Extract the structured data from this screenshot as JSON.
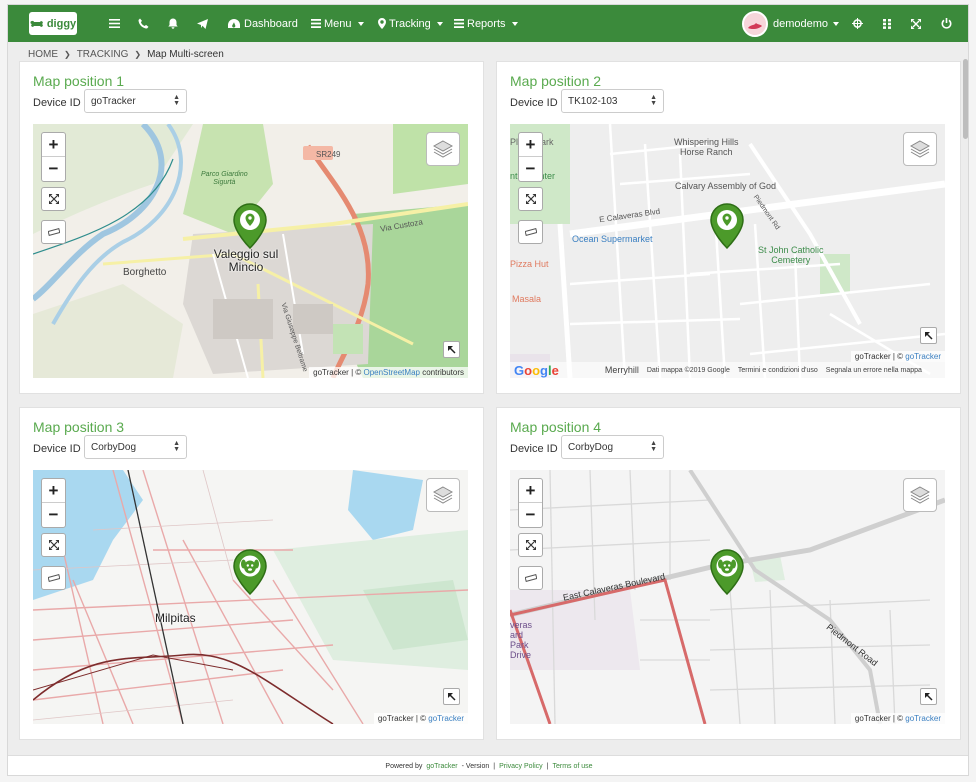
{
  "navbar": {
    "logo_text": "diggy",
    "dashboard": "Dashboard",
    "menu": "Menu",
    "tracking": "Tracking",
    "reports": "Reports",
    "user": "demodemo",
    "icons": [
      "hamburger-icon",
      "phone-icon",
      "bell-icon",
      "send-icon",
      "dashboard-icon",
      "list-icon",
      "map-marker-icon",
      "reports-icon",
      "crosshair-icon",
      "grid-icon",
      "fullscreen-icon",
      "power-icon"
    ],
    "color": "#3b8a3b"
  },
  "breadcrumb": {
    "home": "HOME",
    "tracking": "TRACKING",
    "current": "Map Multi-screen"
  },
  "device_label": "Device ID",
  "panels": [
    {
      "title": "Map position 1",
      "device": "goTracker",
      "attribution_pre": "goTracker | © ",
      "attribution_link": "OpenStreetMap",
      "attribution_post": " contributors",
      "labels": {
        "town": "Valeggio sul\nMincio",
        "village": "Borghetto",
        "park": "Parco Giardino\nSigurtà",
        "road": "SR249",
        "street1": "Via Custoza",
        "street2": "Via Giuseppe Beltrame"
      }
    },
    {
      "title": "Map position 2",
      "device": "TK102-103",
      "attribution_pre": "goTracker | © ",
      "attribution_link": "goTracker",
      "google_bar": {
        "merryhill": "Merryhill",
        "data": "Dati mappa ©2019 Google",
        "terms": "Termini e condizioni d'uso",
        "report": "Segnala un errore nella mappa"
      },
      "labels": {
        "ranch": "Whispering Hills\nHorse Ranch",
        "church": "Calvary Assembly of God",
        "cemetery": "St John Catholic\nCemetery",
        "supermarket": "Ocean Supermarket",
        "pizza": "Pizza Hut",
        "masala": "Masala",
        "blvd": "E Calaveras Blvd",
        "plaza": "Plaza Park",
        "center": "ntro Center",
        "piedmont": "Piedmont Rd"
      }
    },
    {
      "title": "Map position 3",
      "device": "CorbyDog",
      "attribution_pre": "goTracker | © ",
      "attribution_link": "goTracker",
      "labels": {
        "city": "Milpitas"
      }
    },
    {
      "title": "Map position 4",
      "device": "CorbyDog",
      "attribution_pre": "goTracker | © ",
      "attribution_link": "goTracker",
      "labels": {
        "blvd": "East Calaveras Boulevard",
        "piedmont": "Piedmont Road",
        "park": "veras\nard\nPark\nDrive"
      }
    }
  ],
  "footer": {
    "powered": "Powered by",
    "brand": "goTracker",
    "version": "- Version",
    "sep": "|",
    "privacy": "Privacy Policy",
    "sep2": "|",
    "terms": "Terms of use"
  }
}
